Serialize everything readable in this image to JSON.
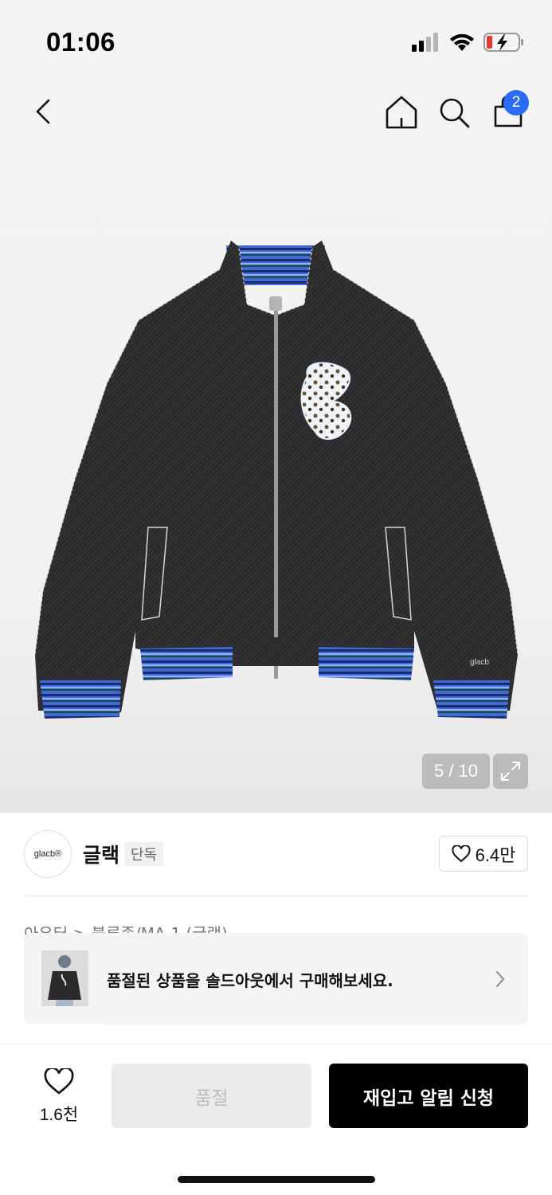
{
  "status": {
    "time": "01:06"
  },
  "nav": {
    "cart_count": "2"
  },
  "gallery": {
    "counter": "5 / 10"
  },
  "brand": {
    "logo_text": "glacb®",
    "name": "글랙",
    "tag": "단독",
    "likes": "6.4만"
  },
  "breadcrumb": "아우터 > 블루종/MA-1 (글랙)",
  "banner": {
    "text": "품절된 상품을 솔드아웃에서 구매해보세요."
  },
  "bottom": {
    "wish_count": "1.6천",
    "soldout_label": "품절",
    "restock_label": "재입고 알림 신청"
  },
  "colors": {
    "accent_blue": "#2a6cf6",
    "primary_black": "#000000"
  },
  "icons": [
    "back-icon",
    "home-icon",
    "search-icon",
    "cart-icon",
    "expand-icon",
    "heart-icon",
    "chevron-right-icon",
    "signal-icon",
    "wifi-icon",
    "battery-icon"
  ]
}
